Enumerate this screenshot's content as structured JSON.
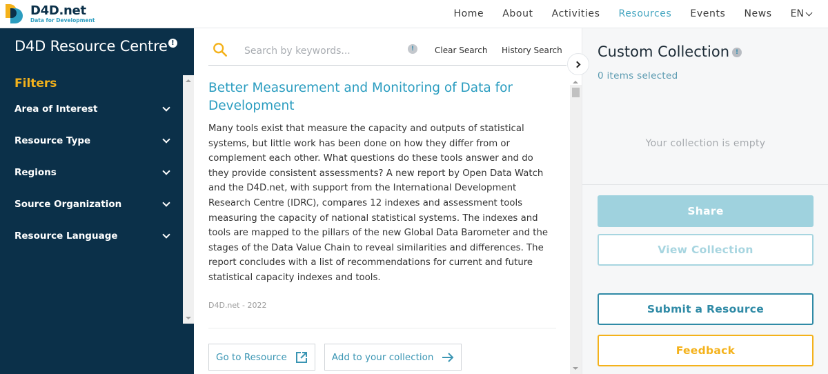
{
  "brand": {
    "name": "D4D.net",
    "tagline": "Data for Development",
    "colors": {
      "navy": "#0b3049",
      "teal": "#2b9dc0",
      "yellow": "#f4b21b"
    }
  },
  "nav": {
    "items": [
      {
        "label": "Home",
        "active": false
      },
      {
        "label": "About",
        "active": false
      },
      {
        "label": "Activities",
        "active": false
      },
      {
        "label": "Resources",
        "active": true
      },
      {
        "label": "Events",
        "active": false
      },
      {
        "label": "News",
        "active": false
      }
    ],
    "language": "EN"
  },
  "sidebar": {
    "title": "D4D Resource Centre",
    "info_icon": "!",
    "filters_label": "Filters",
    "filters": [
      {
        "label": "Area of Interest"
      },
      {
        "label": "Resource Type"
      },
      {
        "label": "Regions"
      },
      {
        "label": "Source Organization"
      },
      {
        "label": "Resource Language"
      }
    ]
  },
  "search": {
    "placeholder": "Search by keywords...",
    "value": "",
    "info_icon": "!",
    "clear_label": "Clear Search",
    "history_label": "History Search"
  },
  "result": {
    "title": "Better Measurement and Monitoring of Data for Development",
    "description": "Many tools exist that measure the capacity and outputs of statistical systems, but little work has been done on how they differ from or complement each other. What questions do these tools answer and do they provide consistent assessments? A new report by Open Data Watch and the D4D.net, with support from the International Development Research Centre (IDRC), compares 12 indexes and assessment tools measuring the capacity of national statistical systems. The indexes and tools are mapped to the pillars of the new Global Data Barometer and the stages of the Data Value Chain to reveal similarities and differences. The report concludes with a list of recommendations for current and future statistical capacity indexes and tools.",
    "meta": "D4D.net - 2022",
    "go_label": "Go to Resource",
    "add_label": "Add to your collection"
  },
  "collection": {
    "title": "Custom Collection",
    "info_icon": "!",
    "count_label": "0 items selected",
    "empty_label": "Your collection is empty",
    "share_label": "Share",
    "view_label": "View Collection",
    "submit_label": "Submit a Resource",
    "feedback_label": "Feedback"
  }
}
